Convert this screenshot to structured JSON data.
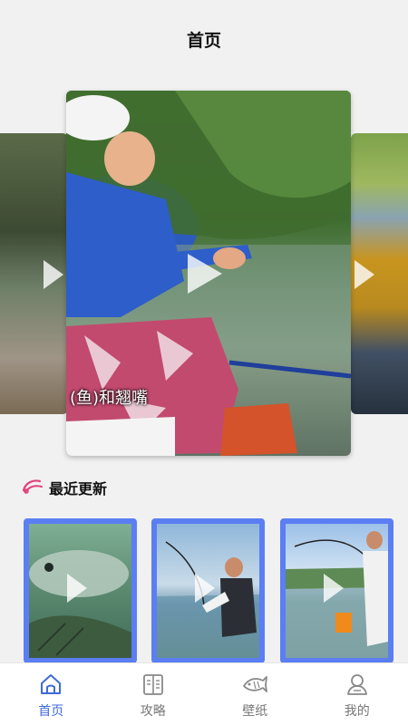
{
  "header": {
    "title": "首页"
  },
  "carousel": {
    "slides": [
      {
        "caption": ""
      },
      {
        "caption": "(鱼)和翘嘴"
      },
      {
        "caption": ""
      }
    ]
  },
  "recent": {
    "title": "最近更新",
    "icon": "fishing-rod-icon"
  },
  "tabbar": {
    "active_color": "#3f6ad8",
    "inactive_color": "#777777",
    "items": [
      {
        "label": "首页",
        "icon": "home-icon",
        "active": true
      },
      {
        "label": "攻略",
        "icon": "book-icon",
        "active": false
      },
      {
        "label": "壁纸",
        "icon": "fish-icon",
        "active": false
      },
      {
        "label": "我的",
        "icon": "user-icon",
        "active": false
      }
    ]
  },
  "colors": {
    "accent": "#5b7ef2",
    "rod_icon": "#e0407a"
  }
}
